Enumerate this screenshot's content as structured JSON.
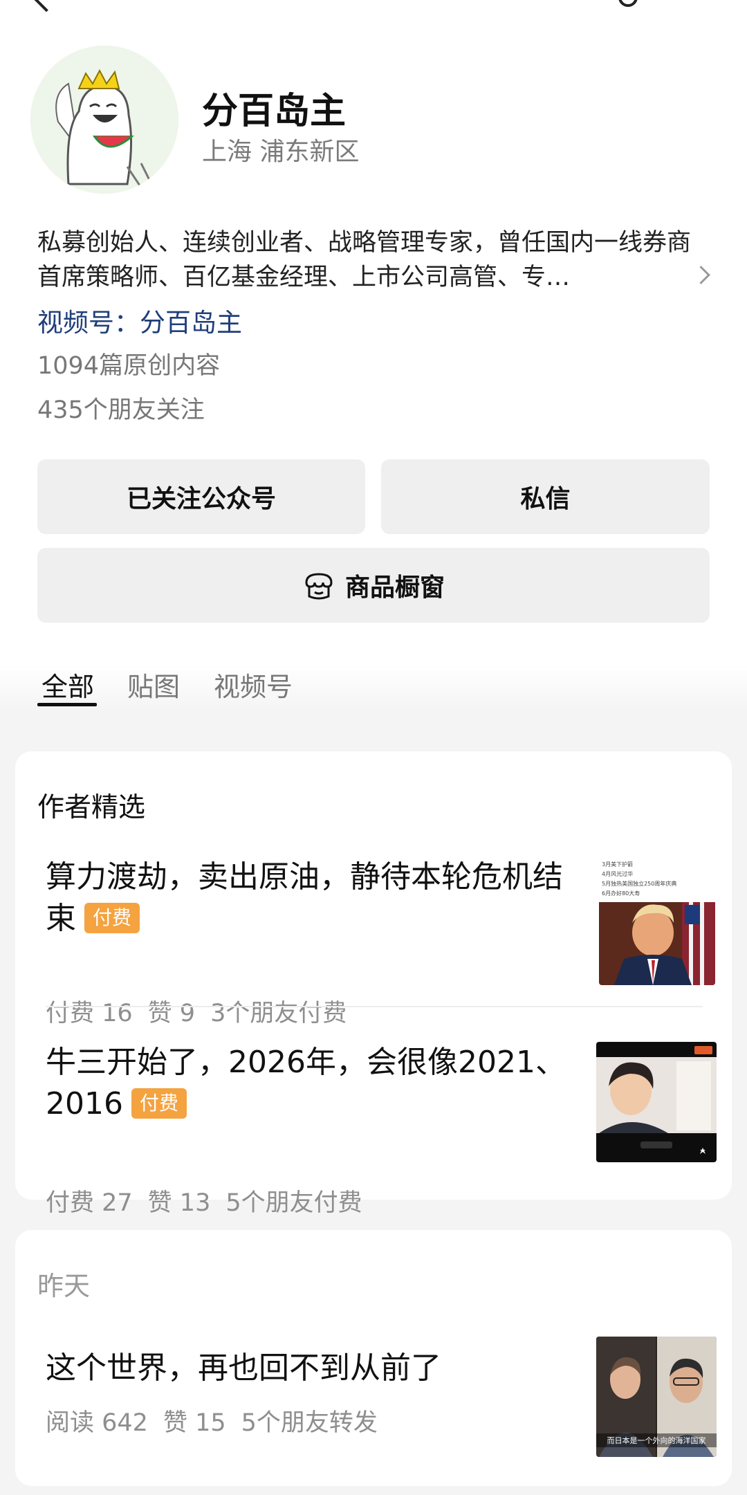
{
  "profile": {
    "name": "分百岛主",
    "location": "上海 浦东新区",
    "bio": "私募创始人、连续创业者、战略管理专家，曾任国内一线券商首席策略师、百亿基金经理、上市公司高管、专…",
    "channel": "视频号：分百岛主",
    "original_count": "1094篇原创内容",
    "friends_following": "435个朋友关注"
  },
  "actions": {
    "follow_label": "已关注公众号",
    "message_label": "私信",
    "shop_label": "商品橱窗"
  },
  "tabs": [
    {
      "label": "全部",
      "active": true
    },
    {
      "label": "贴图",
      "active": false
    },
    {
      "label": "视频号",
      "active": false
    }
  ],
  "featured": {
    "title": "作者精选",
    "articles": [
      {
        "title": "算力渡劫，卖出原油，静待本轮危机结束",
        "badge": "付费",
        "meta_paid": "付费 16",
        "meta_likes": "赞 9",
        "meta_friends": "3个朋友付费",
        "thumb_lines": [
          "3月美下护箭",
          "4月风光过华",
          "5月独热美国独立250周年庆典",
          "6月办好80大寿"
        ]
      },
      {
        "title": "牛三开始了，2026年，会很像2021、2016",
        "badge": "付费",
        "meta_paid": "付费 27",
        "meta_likes": "赞 13",
        "meta_friends": "5个朋友付费"
      }
    ]
  },
  "yesterday": {
    "title": "昨天",
    "articles": [
      {
        "title": "这个世界，再也回不到从前了",
        "meta_reads": "阅读 642",
        "meta_likes": "赞 15",
        "meta_friends": "5个朋友转发",
        "thumb_caption": "而日本是一个外向的海洋国家"
      }
    ]
  },
  "colors": {
    "paid_badge": "#f4a340",
    "channel_link": "#1f3e7a",
    "button_bg": "#efefef"
  }
}
